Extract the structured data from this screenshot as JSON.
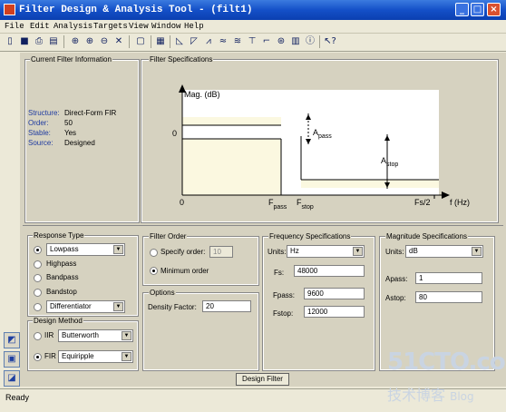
{
  "window": {
    "title": "Filter Design & Analysis Tool -  (filt1)"
  },
  "menu": [
    "File",
    "Edit",
    "Analysis",
    "Targets",
    "View",
    "Window",
    "Help"
  ],
  "current_filter": {
    "title": "Current Filter Information",
    "rows": [
      {
        "label": "Structure:",
        "value": "Direct-Form FIR"
      },
      {
        "label": "Order:",
        "value": "50"
      },
      {
        "label": "Stable:",
        "value": "Yes"
      },
      {
        "label": "Source:",
        "value": "Designed"
      }
    ]
  },
  "filter_specs": {
    "title": "Filter Specifications",
    "mag_label": "Mag. (dB)",
    "zero_y": "0",
    "zero_x": "0",
    "fpass": "F",
    "fpass_sub": "pass",
    "fstop": "F",
    "fstop_sub": "stop",
    "fs2": "Fs/2",
    "freq_label": "f (Hz)",
    "apass": "A",
    "apass_sub": "pass",
    "astop": "A",
    "astop_sub": "stop"
  },
  "response_type": {
    "title": "Response Type",
    "lowpass_value": "Lowpass",
    "highpass": "Highpass",
    "bandpass": "Bandpass",
    "bandstop": "Bandstop",
    "differentiator_value": "Differentiator"
  },
  "design_method": {
    "title": "Design Method",
    "iir": "IIR",
    "iir_value": "Butterworth",
    "fir": "FIR",
    "fir_value": "Equiripple"
  },
  "filter_order": {
    "title": "Filter Order",
    "specify": "Specify order:",
    "specify_value": "10",
    "minimum": "Minimum order"
  },
  "options": {
    "title": "Options",
    "density_label": "Density Factor:",
    "density_value": "20"
  },
  "freq_specs": {
    "title": "Frequency Specifications",
    "units_label": "Units:",
    "units_value": "Hz",
    "fs_label": "Fs:",
    "fs_value": "48000",
    "fpass_label": "Fpass:",
    "fpass_value": "9600",
    "fstop_label": "Fstop:",
    "fstop_value": "12000"
  },
  "mag_specs": {
    "title": "Magnitude Specifications",
    "units_label": "Units:",
    "units_value": "dB",
    "apass_label": "Apass:",
    "apass_value": "1",
    "astop_label": "Astop:",
    "astop_value": "80"
  },
  "design_button": "Design Filter",
  "status": "Ready",
  "watermark": {
    "line1": "51CTO.com",
    "line2": "技术博客",
    "line3": "Blog"
  }
}
